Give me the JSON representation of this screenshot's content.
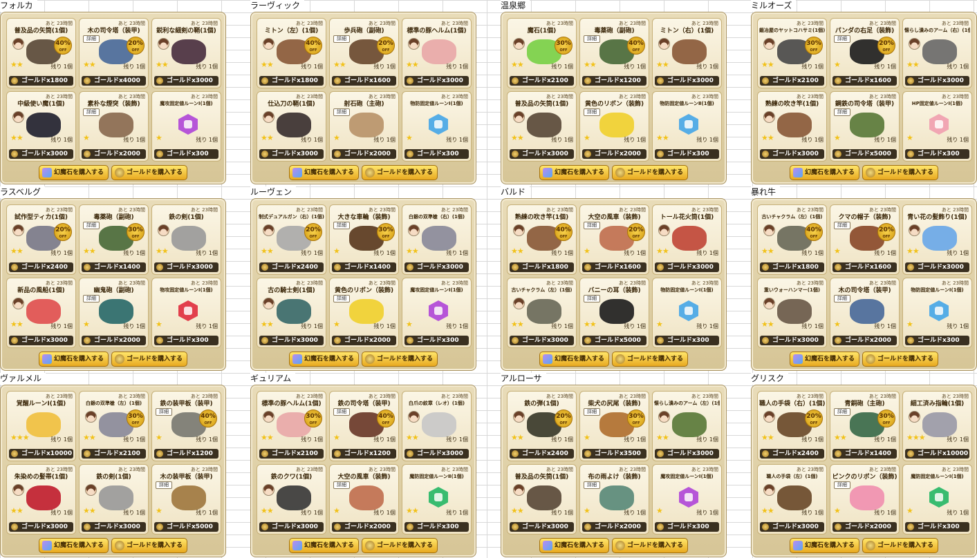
{
  "shops": [
    {
      "name": "フォルカ",
      "items": [
        {
          "name": "普及品の矢筒(1個)",
          "timer": "あと 23時間",
          "avatar": true,
          "color": "#5a4a3a",
          "discount": "40%",
          "off": "OFF",
          "stars": "★★",
          "stock": "残り 1個",
          "price": "ゴールドx1800"
        },
        {
          "name": "木の司令塔（装甲)",
          "timer": "あと 23時間",
          "detail": "詳細",
          "avatar": false,
          "color": "#4a6a9a",
          "discount": "20%",
          "off": "OFF",
          "stars": "★★",
          "stock": "残り 1個",
          "price": "ゴールドx4000"
        },
        {
          "name": "鋭利な細剣の鞘(1個)",
          "timer": "あと 23時間",
          "avatar": true,
          "color": "#4a3040",
          "stars": "★★",
          "stock": "残り 1個",
          "price": "ゴールドx3000"
        },
        {
          "name": "中級使い魔(1個)",
          "timer": "あと 23時間",
          "avatar": true,
          "color": "#222230",
          "stars": "★★",
          "stock": "残り 1個",
          "price": "ゴールドx3000"
        },
        {
          "name": "素朴な煙突（装飾)",
          "timer": "あと 23時間",
          "detail": "詳細",
          "avatar": false,
          "color": "#8a6a50",
          "stars": "★",
          "stock": "残り 1個",
          "price": "ゴールドx2000"
        },
        {
          "name": "魔攻固定値ルーンⅠ(1個)",
          "small": true,
          "timer": "あと 23時間",
          "avatar": false,
          "gem": true,
          "color": "#b048d8",
          "stars": "★",
          "stock": "残り 1個",
          "price": "ゴールドx300"
        }
      ]
    },
    {
      "name": "ラーヴィック",
      "items": [
        {
          "name": "ミトン（左）(1個)",
          "timer": "あと 23時間",
          "avatar": true,
          "color": "#8a5a3a",
          "discount": "40%",
          "off": "OFF",
          "stars": "★★",
          "stock": "残り 1個",
          "price": "ゴールドx1800"
        },
        {
          "name": "歩兵砲（副砲)",
          "timer": "あと 23時間",
          "detail": "詳細",
          "avatar": false,
          "color": "#6a4a30",
          "discount": "20%",
          "off": "OFF",
          "stars": "★★",
          "stock": "残り 1個",
          "price": "ゴールドx1600"
        },
        {
          "name": "標準の豚ヘルム(1個)",
          "timer": "あと 23時間",
          "avatar": true,
          "color": "#e8a8a8",
          "stars": "★★",
          "stock": "残り 1個",
          "price": "ゴールドx3000"
        },
        {
          "name": "仕込刀の鞘(1個)",
          "timer": "あと 23時間",
          "avatar": true,
          "color": "#3a3030",
          "stars": "★★",
          "stock": "残り 1個",
          "price": "ゴールドx3000"
        },
        {
          "name": "射石砲（主砲)",
          "timer": "あと 23時間",
          "detail": "詳細",
          "avatar": false,
          "color": "#b8946a",
          "stars": "★",
          "stock": "残り 1個",
          "price": "ゴールドx2000"
        },
        {
          "name": "物防固定値ルーンⅠ(1個)",
          "small": true,
          "timer": "あと 23時間",
          "avatar": false,
          "gem": true,
          "color": "#48a8e8",
          "stars": "★",
          "stock": "残り 1個",
          "price": "ゴールドx300"
        }
      ]
    },
    {
      "name": "温泉郷",
      "items": [
        {
          "name": "魔石(1個)",
          "timer": "あと 23時間",
          "avatar": true,
          "color": "#7ad048",
          "discount": "30%",
          "off": "OFF",
          "stars": "★★",
          "stock": "残り 1個",
          "price": "ゴールドx2100"
        },
        {
          "name": "毒薬砲（副砲)",
          "timer": "あと 23時間",
          "detail": "詳細",
          "avatar": false,
          "color": "#4a6a3a",
          "discount": "40%",
          "off": "OFF",
          "stars": "★★",
          "stock": "残り 1個",
          "price": "ゴールドx1200"
        },
        {
          "name": "ミトン（右）(1個)",
          "timer": "あと 23時間",
          "avatar": true,
          "color": "#8a5a3a",
          "stars": "★★",
          "stock": "残り 1個",
          "price": "ゴールドx3000"
        },
        {
          "name": "普及品の矢筒(1個)",
          "timer": "あと 23時間",
          "avatar": true,
          "color": "#5a4a3a",
          "stars": "★★",
          "stock": "残り 1個",
          "price": "ゴールドx3000"
        },
        {
          "name": "黄色のリボン（装飾)",
          "timer": "あと 23時間",
          "detail": "詳細",
          "avatar": false,
          "color": "#f0d030",
          "stars": "★",
          "stock": "残り 1個",
          "price": "ゴールドx2000"
        },
        {
          "name": "物防固定値ルーンⅡ(1個)",
          "small": true,
          "timer": "あと 23時間",
          "avatar": false,
          "gem": true,
          "color": "#48a8e8",
          "stars": "★★",
          "stock": "残り 1個",
          "price": "ゴールドx300"
        }
      ]
    },
    {
      "name": "ミルオーズ",
      "items": [
        {
          "name": "鍛冶屋のヤットコハサミ(1個)",
          "small": true,
          "timer": "あと 23時間",
          "avatar": true,
          "color": "#4a4a4a",
          "discount": "30%",
          "off": "OFF",
          "stars": "★★",
          "stock": "残り 1個",
          "price": "ゴールドx2100"
        },
        {
          "name": "パンダの右足（装飾)",
          "timer": "あと 23時間",
          "detail": "詳細",
          "avatar": false,
          "color": "#202020",
          "discount": "20%",
          "off": "OFF",
          "stars": "★",
          "stock": "残り 1個",
          "price": "ゴールドx1600"
        },
        {
          "name": "懐らし潰みのアーム（右）(1個)",
          "small": true,
          "timer": "あと 23時間",
          "avatar": true,
          "color": "#6a6a6a",
          "stars": "★★",
          "stock": "残り 1個",
          "price": "ゴールドx3000"
        },
        {
          "name": "熟練の吹き竿(1個)",
          "timer": "あと 23時間",
          "avatar": true,
          "color": "#8a5a3a",
          "stars": "★★",
          "stock": "残り 1個",
          "price": "ゴールドx3000"
        },
        {
          "name": "鋼鉄の司令塔（装甲)",
          "timer": "あと 23時間",
          "detail": "詳細",
          "avatar": false,
          "color": "#5a7a3a",
          "stars": "★",
          "stock": "残り 1個",
          "price": "ゴールドx5000"
        },
        {
          "name": "HP固定値ルーンⅠ(1個)",
          "small": true,
          "timer": "あと 23時間",
          "avatar": false,
          "gem": true,
          "color": "#f0a0b0",
          "stars": "★",
          "stock": "残り 1個",
          "price": "ゴールドx300"
        }
      ]
    },
    {
      "name": "ラスベルグ",
      "items": [
        {
          "name": "試作型ティカ(1個)",
          "timer": "あと 23時間",
          "avatar": true,
          "color": "#7a7a8a",
          "discount": "20%",
          "off": "OFF",
          "stars": "★★",
          "stock": "残り 1個",
          "price": "ゴールドx2400"
        },
        {
          "name": "毒薬砲（副砲)",
          "timer": "あと 23時間",
          "detail": "詳細",
          "avatar": false,
          "color": "#4a6a3a",
          "discount": "30%",
          "off": "OFF",
          "stars": "★★",
          "stock": "残り 1個",
          "price": "ゴールドx1400"
        },
        {
          "name": "鉄の剣(1個)",
          "timer": "あと 23時間",
          "avatar": true,
          "color": "#9a9a9a",
          "stars": "★★",
          "stock": "残り 1個",
          "price": "ゴールドx3000"
        },
        {
          "name": "新品の風船(1個)",
          "timer": "あと 23時間",
          "avatar": true,
          "color": "#e05050",
          "stars": "★★",
          "stock": "残り 1個",
          "price": "ゴールドx3000"
        },
        {
          "name": "幽鬼砲（副砲)",
          "timer": "あと 23時間",
          "detail": "詳細",
          "avatar": false,
          "color": "#2a6a6a",
          "stars": "★",
          "stock": "残り 1個",
          "price": "ゴールドx2000"
        },
        {
          "name": "物攻固定値ルーンⅠ(1個)",
          "small": true,
          "timer": "あと 23時間",
          "avatar": false,
          "gem": true,
          "color": "#e03040",
          "stars": "★",
          "stock": "残り 1個",
          "price": "ゴールドx300"
        }
      ]
    },
    {
      "name": "ルーヴェン",
      "items": [
        {
          "name": "制式デュアルガン（右）(1個)",
          "small": true,
          "timer": "あと 23時間",
          "avatar": true,
          "color": "#aaaaaa",
          "discount": "20%",
          "off": "OFF",
          "stars": "★★",
          "stock": "残り 1個",
          "price": "ゴールドx2400"
        },
        {
          "name": "大きな車輪（装飾)",
          "timer": "あと 23時間",
          "detail": "詳細",
          "avatar": false,
          "color": "#5a3a20",
          "discount": "30%",
          "off": "OFF",
          "stars": "★",
          "stock": "残り 1個",
          "price": "ゴールドx1400"
        },
        {
          "name": "白銀の双準槍（右）(1個)",
          "small": true,
          "timer": "あと 23時間",
          "avatar": true,
          "color": "#8a8a9a",
          "stars": "★★",
          "stock": "残り 1個",
          "price": "ゴールドx3000"
        },
        {
          "name": "古の騎士剣(1個)",
          "timer": "あと 23時間",
          "avatar": true,
          "color": "#3a6a6a",
          "stars": "★★",
          "stock": "残り 1個",
          "price": "ゴールドx3000"
        },
        {
          "name": "黄色のリボン（装飾)",
          "timer": "あと 23時間",
          "detail": "詳細",
          "avatar": false,
          "color": "#f0d030",
          "stars": "★",
          "stock": "残り 1個",
          "price": "ゴールドx2000"
        },
        {
          "name": "魔攻固定値ルーンⅠ(1個)",
          "small": true,
          "timer": "あと 23時間",
          "avatar": false,
          "gem": true,
          "color": "#b048d8",
          "stars": "★",
          "stock": "残り 1個",
          "price": "ゴールドx300"
        }
      ]
    },
    {
      "name": "バルド",
      "items": [
        {
          "name": "熟練の吹き竿(1個)",
          "timer": "あと 23時間",
          "avatar": true,
          "color": "#8a5a3a",
          "discount": "40%",
          "off": "OFF",
          "stars": "★★",
          "stock": "残り 1個",
          "price": "ゴールドx1800"
        },
        {
          "name": "大空の風車（装飾)",
          "timer": "あと 23時間",
          "detail": "詳細",
          "avatar": false,
          "color": "#c07050",
          "discount": "20%",
          "off": "OFF",
          "stars": "★",
          "stock": "残り 1個",
          "price": "ゴールドx1600"
        },
        {
          "name": "トール花火筒(1個)",
          "timer": "あと 23時間",
          "avatar": true,
          "color": "#c04838",
          "stars": "★★",
          "stock": "残り 1個",
          "price": "ゴールドx3000"
        },
        {
          "name": "古いチャクラム（左）(1個)",
          "small": true,
          "timer": "あと 23時間",
          "avatar": true,
          "color": "#6a6a5a",
          "stars": "★★",
          "stock": "残り 1個",
          "price": "ゴールドx3000"
        },
        {
          "name": "バニーの耳（装飾)",
          "timer": "あと 23時間",
          "detail": "詳細",
          "avatar": false,
          "color": "#202020",
          "stars": "★★",
          "stock": "残り 1個",
          "price": "ゴールドx5000"
        },
        {
          "name": "物防固定値ルーンⅠ(1個)",
          "small": true,
          "timer": "あと 23時間",
          "avatar": false,
          "gem": true,
          "color": "#48a8e8",
          "stars": "★",
          "stock": "残り 1個",
          "price": "ゴールドx300"
        }
      ]
    },
    {
      "name": "暴れ牛",
      "items": [
        {
          "name": "古いチャクラム（左）(1個)",
          "small": true,
          "timer": "あと 23時間",
          "avatar": true,
          "color": "#6a6a5a",
          "discount": "40%",
          "off": "OFF",
          "stars": "★★",
          "stock": "残り 1個",
          "price": "ゴールドx1800"
        },
        {
          "name": "クマの帽子（装飾)",
          "timer": "あと 23時間",
          "detail": "詳細",
          "avatar": false,
          "color": "#8a4a2a",
          "discount": "20%",
          "off": "OFF",
          "stars": "★",
          "stock": "残り 1個",
          "price": "ゴールドx1600"
        },
        {
          "name": "青い花の髪飾り(1個)",
          "timer": "あと 23時間",
          "avatar": true,
          "color": "#6aa8e8",
          "stars": "★★",
          "stock": "残り 1個",
          "price": "ゴールドx3000"
        },
        {
          "name": "重いウォーハンマー(1個)",
          "small": true,
          "timer": "あと 23時間",
          "avatar": true,
          "color": "#6a5a4a",
          "stars": "★★",
          "stock": "残り 1個",
          "price": "ゴールドx3000"
        },
        {
          "name": "木の司令塔（装甲)",
          "timer": "あと 23時間",
          "detail": "詳細",
          "avatar": false,
          "color": "#4a6a9a",
          "stars": "★",
          "stock": "残り 1個",
          "price": "ゴールドx2000"
        },
        {
          "name": "物防固定値ルーンⅠ(1個)",
          "small": true,
          "timer": "あと 23時間",
          "avatar": false,
          "gem": true,
          "color": "#48a8e8",
          "stars": "★",
          "stock": "残り 1個",
          "price": "ゴールドx300"
        }
      ]
    },
    {
      "name": "ヴァルメル",
      "items": [
        {
          "name": "覚醒ルーンⅠ(1個)",
          "timer": "あと 23時間",
          "avatar": false,
          "color": "#f0c040",
          "stars": "★★★",
          "stock": "残り 1個",
          "price": "ゴールドx10000"
        },
        {
          "name": "白銀の双準槍（左）(1個)",
          "small": true,
          "timer": "あと 23時間",
          "avatar": true,
          "color": "#8a8a9a",
          "discount": "30%",
          "off": "OFF",
          "stars": "★★",
          "stock": "残り 1個",
          "price": "ゴールドx2100"
        },
        {
          "name": "鉄の装甲板（装甲)",
          "timer": "あと 23時間",
          "detail": "詳細",
          "avatar": false,
          "color": "#7a7a72",
          "discount": "40%",
          "off": "OFF",
          "stars": "★",
          "stock": "残り 1個",
          "price": "ゴールドx1200"
        },
        {
          "name": "朱染めの髪帯(1個)",
          "timer": "あと 23時間",
          "avatar": true,
          "color": "#c02030",
          "stars": "★★",
          "stock": "残り 1個",
          "price": "ゴールドx3000"
        },
        {
          "name": "鉄の剣(1個)",
          "timer": "あと 23時間",
          "avatar": true,
          "color": "#9a9a9a",
          "stars": "★★",
          "stock": "残り 1個",
          "price": "ゴールドx3000"
        },
        {
          "name": "木の装甲板（装甲)",
          "timer": "あと 23時間",
          "detail": "詳細",
          "avatar": false,
          "color": "#a07840",
          "stars": "★",
          "stock": "残り 1個",
          "price": "ゴールドx5000"
        }
      ]
    },
    {
      "name": "ギュリアム",
      "items": [
        {
          "name": "標準の豚ヘルム(1個)",
          "timer": "あと 23時間",
          "avatar": true,
          "color": "#e8a8a8",
          "discount": "30%",
          "off": "OFF",
          "stars": "★★",
          "stock": "残り 1個",
          "price": "ゴールドx2100"
        },
        {
          "name": "鉄の司令塔（装甲)",
          "timer": "あと 23時間",
          "detail": "詳細",
          "avatar": false,
          "color": "#6a3a2a",
          "discount": "40%",
          "off": "OFF",
          "stars": "★",
          "stock": "残り 1個",
          "price": "ゴールドx1200"
        },
        {
          "name": "白爪の紋章（レオ）(1個)",
          "small": true,
          "timer": "あと 23時間",
          "avatar": true,
          "color": "#c8c8c8",
          "stars": "★★",
          "stock": "残り 1個",
          "price": "ゴールドx3000"
        },
        {
          "name": "鉄のクワ(1個)",
          "timer": "あと 23時間",
          "avatar": true,
          "color": "#3a3a3a",
          "stars": "★★",
          "stock": "残り 1個",
          "price": "ゴールドx3000"
        },
        {
          "name": "大空の風車（装飾)",
          "timer": "あと 23時間",
          "detail": "詳細",
          "avatar": false,
          "color": "#c07050",
          "stars": "★",
          "stock": "残り 1個",
          "price": "ゴールドx2000"
        },
        {
          "name": "魔防固定値ルーンⅡ(1個)",
          "small": true,
          "timer": "あと 23時間",
          "avatar": false,
          "gem": true,
          "color": "#28b868",
          "stars": "★★",
          "stock": "残り 1個",
          "price": "ゴールドx300"
        }
      ]
    },
    {
      "name": "アルローサ",
      "items": [
        {
          "name": "鉄の弾(1個)",
          "timer": "あと 23時間",
          "avatar": true,
          "color": "#3a3a2a",
          "discount": "20%",
          "off": "OFF",
          "stars": "★★",
          "stock": "残り 1個",
          "price": "ゴールドx2400"
        },
        {
          "name": "柴犬の尻尾（装飾)",
          "timer": "あと 23時間",
          "detail": "詳細",
          "avatar": false,
          "color": "#b07030",
          "discount": "30%",
          "off": "OFF",
          "stars": "★",
          "stock": "残り 1個",
          "price": "ゴールドx3500"
        },
        {
          "name": "懐らし潰みのアーム（左）(1個)",
          "small": true,
          "timer": "あと 23時間",
          "avatar": true,
          "color": "#5a7a3a",
          "stars": "★★",
          "stock": "残り 1個",
          "price": "ゴールドx3000"
        },
        {
          "name": "普及品の矢筒(1個)",
          "timer": "あと 23時間",
          "avatar": true,
          "color": "#5a4a3a",
          "stars": "★★",
          "stock": "残り 1個",
          "price": "ゴールドx3000"
        },
        {
          "name": "布の雨よけ（装飾)",
          "timer": "あと 23時間",
          "detail": "詳細",
          "avatar": false,
          "color": "#5a8a7a",
          "stars": "★",
          "stock": "残り 1個",
          "price": "ゴールドx2000"
        },
        {
          "name": "魔攻固定値ルーンⅠ(1個)",
          "small": true,
          "timer": "あと 23時間",
          "avatar": false,
          "gem": true,
          "color": "#b048d8",
          "stars": "★",
          "stock": "残り 1個",
          "price": "ゴールドx300"
        }
      ]
    },
    {
      "name": "グリスク",
      "items": [
        {
          "name": "職人の手袋（右）(1個)",
          "timer": "あと 23時間",
          "avatar": true,
          "color": "#6a4a2a",
          "discount": "20%",
          "off": "OFF",
          "stars": "★★",
          "stock": "残り 1個",
          "price": "ゴールドx2400"
        },
        {
          "name": "青銅砲（主砲)",
          "timer": "あと 23時間",
          "detail": "詳細",
          "avatar": false,
          "color": "#3a6a4a",
          "discount": "30%",
          "off": "OFF",
          "stars": "★★",
          "stock": "残り 1個",
          "price": "ゴールドx1400"
        },
        {
          "name": "細工済み指輪(1個)",
          "timer": "あと 23時間",
          "avatar": true,
          "color": "#9a9aa8",
          "stars": "★★★",
          "stock": "残り 1個",
          "price": "ゴールドx10000"
        },
        {
          "name": "職人の手袋（左）(1個)",
          "small": true,
          "timer": "あと 23時間",
          "avatar": true,
          "color": "#6a4a2a",
          "stars": "★★",
          "stock": "残り 1個",
          "price": "ゴールドx3000"
        },
        {
          "name": "ピンクのリボン（装飾)",
          "timer": "あと 23時間",
          "detail": "詳細",
          "avatar": false,
          "color": "#f090b0",
          "stars": "★",
          "stock": "残り 1個",
          "price": "ゴールドx2000"
        },
        {
          "name": "魔防固定値ルーンⅠ(1個)",
          "small": true,
          "timer": "あと 23時間",
          "avatar": false,
          "gem": true,
          "color": "#28b868",
          "stars": "★",
          "stock": "残り 1個",
          "price": "ゴールドx300"
        }
      ]
    }
  ],
  "buttons": {
    "gem": "幻魔石を購入する",
    "gold": "ゴールドを購入する"
  }
}
